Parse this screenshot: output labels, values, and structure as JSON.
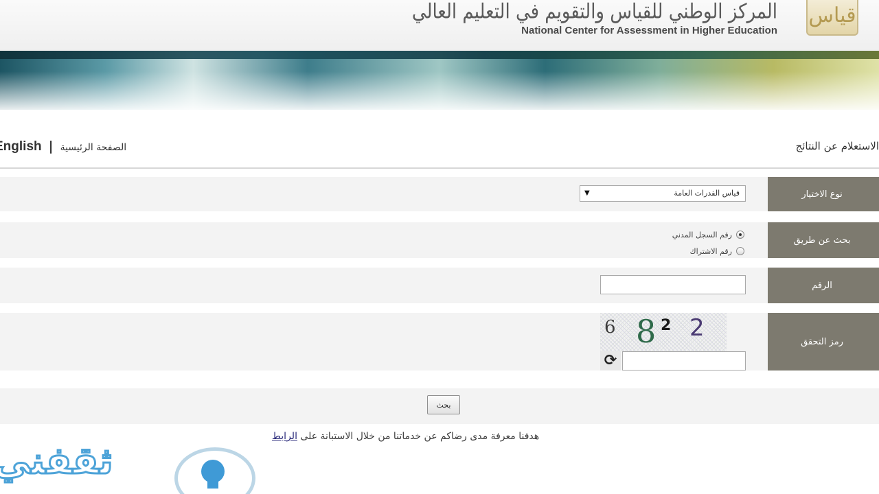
{
  "header": {
    "logo_ar": "المركز الوطني للقياس والتقويم في التعليم العالي",
    "logo_en": "National Center for Assessment in Higher Education",
    "emblem": "قياس"
  },
  "nav": {
    "title": "الاستعلام عن النتائج",
    "home_link": "الصفحة الرئيسية",
    "separator": "|",
    "english_link": "English"
  },
  "form": {
    "exam_type": {
      "label": "نوع الاختيار",
      "selected": "قياس القدرات العامة",
      "arrow": "▼"
    },
    "search_by": {
      "label": "بحث عن طريق",
      "options": [
        {
          "label": "رقم السجل المدني",
          "checked": true
        },
        {
          "label": "رقم الاشتراك",
          "checked": false
        }
      ]
    },
    "number": {
      "label": "الرقم",
      "value": ""
    },
    "captcha": {
      "label": "رمز التحقق",
      "chars": [
        "6",
        "8",
        "2",
        "2"
      ],
      "input_value": "",
      "refresh_icon": "refresh-icon"
    },
    "submit_label": "بحث"
  },
  "survey": {
    "text": "هدفنا معرفة مدى رضاكم عن خدماتنا من خلال الاستبانة على ",
    "link": "الرابط"
  },
  "watermark": {
    "text": "ثقفني"
  },
  "colors": {
    "label_bg": "#7d7a6f",
    "row_bg": "#f3f3f3",
    "watermark": "#4da3d8"
  }
}
